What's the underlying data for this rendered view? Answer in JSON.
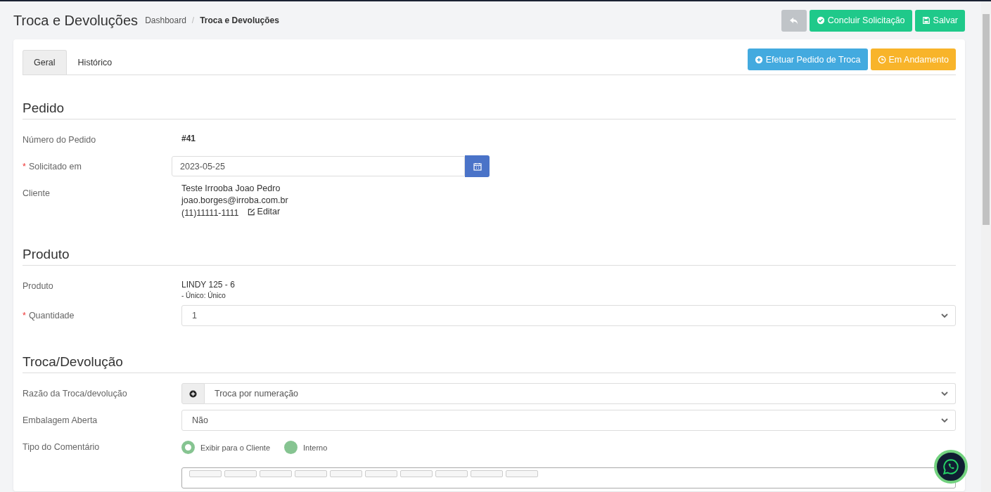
{
  "required_mark": "*",
  "header": {
    "title": "Troca e Devoluções",
    "breadcrumb_separator": "/",
    "breadcrumb": [
      {
        "label": "Dashboard",
        "current": false
      },
      {
        "label": "Troca e Devoluções",
        "current": true
      }
    ],
    "buttons": [
      {
        "kind": "back"
      },
      {
        "kind": "check",
        "label": "Concluir Solicitação"
      },
      {
        "kind": "save",
        "label": "Salvar"
      }
    ]
  },
  "tabs": [
    {
      "label": "Geral",
      "selected": true
    },
    {
      "label": "Histórico",
      "selected": false
    }
  ],
  "card_buttons": [
    {
      "kind": "plus",
      "label": "Efetuar Pedido de Troca"
    },
    {
      "kind": "clock",
      "label": "Em Andamento"
    }
  ],
  "sections": [
    {
      "title": "Pedido",
      "fields": [
        {
          "kind": "text",
          "label": "Número do Pedido",
          "required": false,
          "value": "#41"
        },
        {
          "kind": "date",
          "label": "Solicitado em",
          "required": true,
          "value": "2023-05-25"
        },
        {
          "kind": "client",
          "label": "Cliente",
          "required": false,
          "lines": [
            "Teste Irrooba Joao Pedro",
            "joao.borges@irroba.com.br",
            "(11)11111-1111"
          ],
          "link": "Editar"
        }
      ]
    },
    {
      "title": "Produto",
      "fields": [
        {
          "kind": "product",
          "label": "Produto",
          "required": false,
          "value": "LINDY 125 - 6",
          "sub": "- Único: Único"
        },
        {
          "kind": "select",
          "label": "Quantidade",
          "required": true,
          "value": "1"
        }
      ]
    },
    {
      "title": "Troca/Devolução",
      "fields": [
        {
          "kind": "addon-select",
          "label": "Razão da Troca/devolução",
          "required": false,
          "value": "Troca por numeração"
        },
        {
          "kind": "select",
          "label": "Embalagem Aberta",
          "required": false,
          "value": "Não"
        },
        {
          "kind": "radio",
          "label": "Tipo do Comentário",
          "required": false,
          "options": [
            {
              "label": "Exibir para o Cliente",
              "selected": true
            },
            {
              "label": "Interno",
              "selected": false
            }
          ]
        }
      ]
    }
  ]
}
